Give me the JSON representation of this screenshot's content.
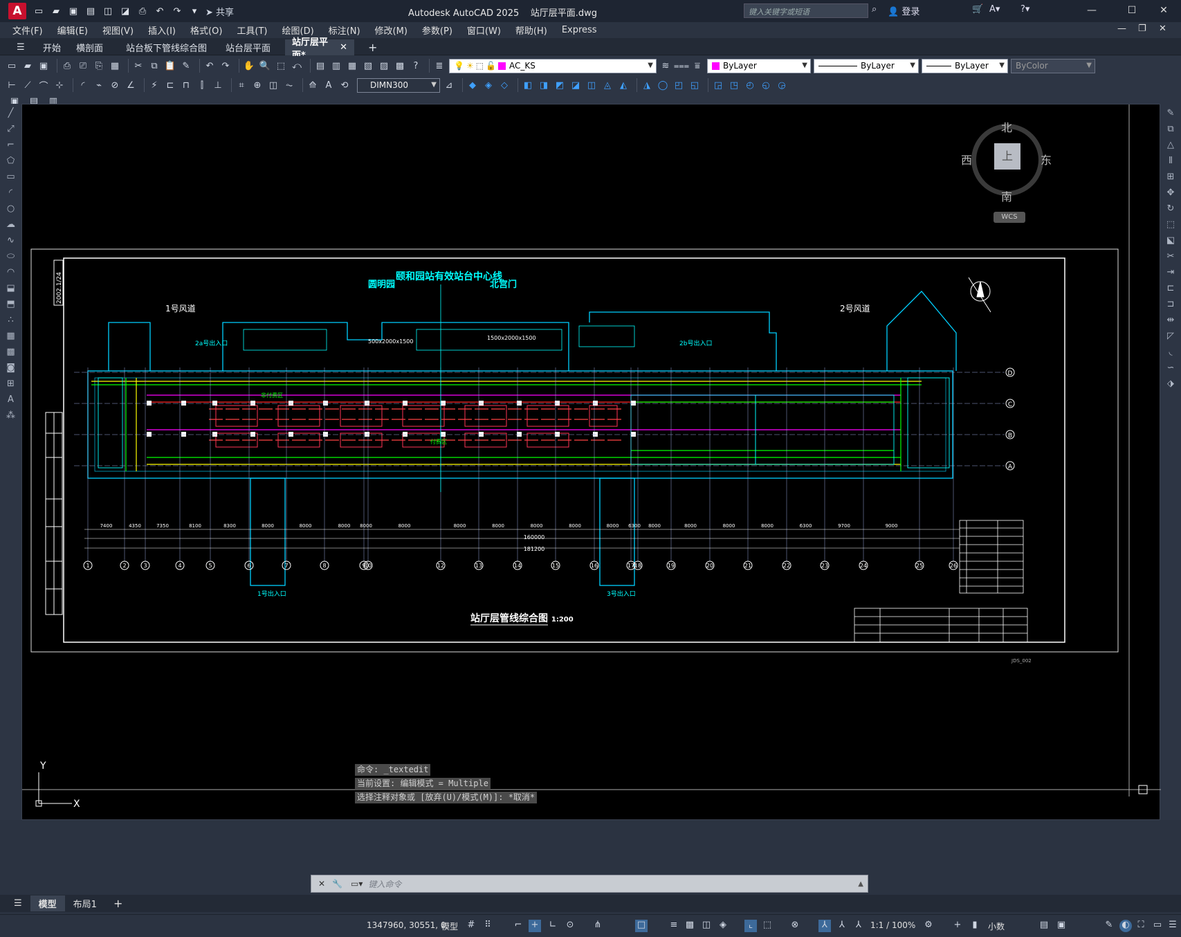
{
  "app": {
    "title": "Autodesk AutoCAD 2025",
    "file": "站厅层平面.dwg",
    "share_label": "共享",
    "login_label": "登录",
    "search_placeholder": "键入关键字或短语",
    "logo_letter": "A"
  },
  "menu": [
    "文件(F)",
    "编辑(E)",
    "视图(V)",
    "插入(I)",
    "格式(O)",
    "工具(T)",
    "绘图(D)",
    "标注(N)",
    "修改(M)",
    "参数(P)",
    "窗口(W)",
    "帮助(H)",
    "Express"
  ],
  "doc_tabs": [
    {
      "label": "开始",
      "active": false
    },
    {
      "label": "横剖面",
      "active": false
    },
    {
      "label": "站台板下管线综合图",
      "active": false
    },
    {
      "label": "站台层平面",
      "active": false
    },
    {
      "label": "站厅层平面*",
      "active": true
    }
  ],
  "properties": {
    "layer": "AC_KS",
    "color": "ByLayer",
    "linetype": "ByLayer",
    "lineweight": "ByLayer",
    "plotstyle": "ByColor",
    "dimstyle": "DIMN300"
  },
  "viewcube": {
    "north": "北",
    "south": "南",
    "east": "东",
    "west": "西",
    "top": "上",
    "ucs": "WCS"
  },
  "drawing": {
    "title": "站厅层管线综合图",
    "scale": "1:200",
    "center_line_label": "颐和园站有效站台中心线",
    "left_station": "圆明园",
    "right_station": "北宫门",
    "vent_1": "1号风道",
    "vent_2": "2号风道",
    "entrance_2a": "2a号出入口",
    "entrance_2b": "2b号出入口",
    "entrance_1": "1号出入口",
    "entrance_3": "3号出入口",
    "non_paid": "非付费区",
    "paid": "付费区",
    "duct_a": "500x2000x1500",
    "duct_b": "1500x2000x1500",
    "dims": [
      "7400",
      "4350",
      "7350",
      "8100",
      "8300",
      "8000",
      "8000",
      "8000",
      "8000",
      "8000",
      "8000",
      "8000",
      "8000",
      "8000",
      "8000",
      "6300",
      "8000",
      "8000",
      "8000",
      "8000",
      "6300",
      "9700",
      "9000"
    ],
    "total_a": "160000",
    "total_b": "181200",
    "axis_numbers": [
      "1",
      "2",
      "3",
      "4",
      "5",
      "6",
      "7",
      "8",
      "9",
      "10",
      "12",
      "13",
      "14",
      "15",
      "16",
      "17",
      "18",
      "19",
      "20",
      "21",
      "22",
      "23",
      "24",
      "25",
      "26"
    ],
    "axis_letters": [
      "D",
      "C",
      "B",
      "A"
    ],
    "side_label": "2002.1/24",
    "jds": "JDS_002"
  },
  "command": {
    "history": [
      "命令: _textedit",
      "当前设置: 编辑模式 = Multiple",
      "选择注释对象或 [放弃(U)/模式(M)]: *取消*"
    ],
    "placeholder": "键入命令"
  },
  "layout_tabs": [
    {
      "label": "模型",
      "active": true
    },
    {
      "label": "布局1",
      "active": false
    }
  ],
  "status": {
    "coords": "1347960, 30551, 0",
    "model": "模型",
    "scale": "1:1 / 100%",
    "units": "小数"
  },
  "ucs_axes": {
    "x": "X",
    "y": "Y"
  }
}
